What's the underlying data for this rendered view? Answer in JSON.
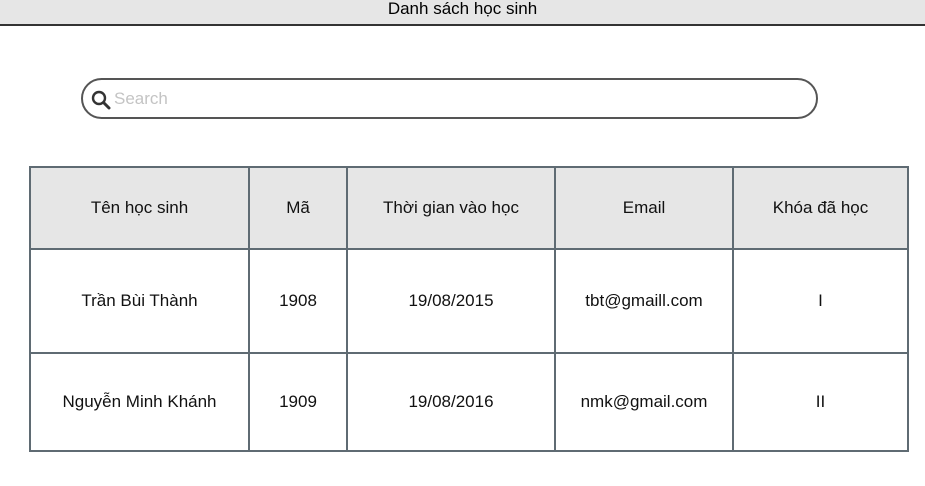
{
  "window": {
    "title": "Danh sách học sinh"
  },
  "search": {
    "placeholder": "Search",
    "value": "",
    "icon": "search-icon"
  },
  "table": {
    "columns": [
      "Tên học sinh",
      "Mã",
      "Thời gian vào học",
      "Email",
      "Khóa đã học"
    ],
    "rows": [
      [
        "Trần Bùi Thành",
        "1908",
        "19/08/2015",
        "tbt@gmaill.com",
        "I"
      ],
      [
        "Nguyễn Minh Khánh",
        "1909",
        "19/08/2016",
        "nmk@gmail.com",
        "II"
      ]
    ]
  },
  "colors": {
    "header_bg": "#e6e6e6",
    "border": "#5f6b73"
  }
}
